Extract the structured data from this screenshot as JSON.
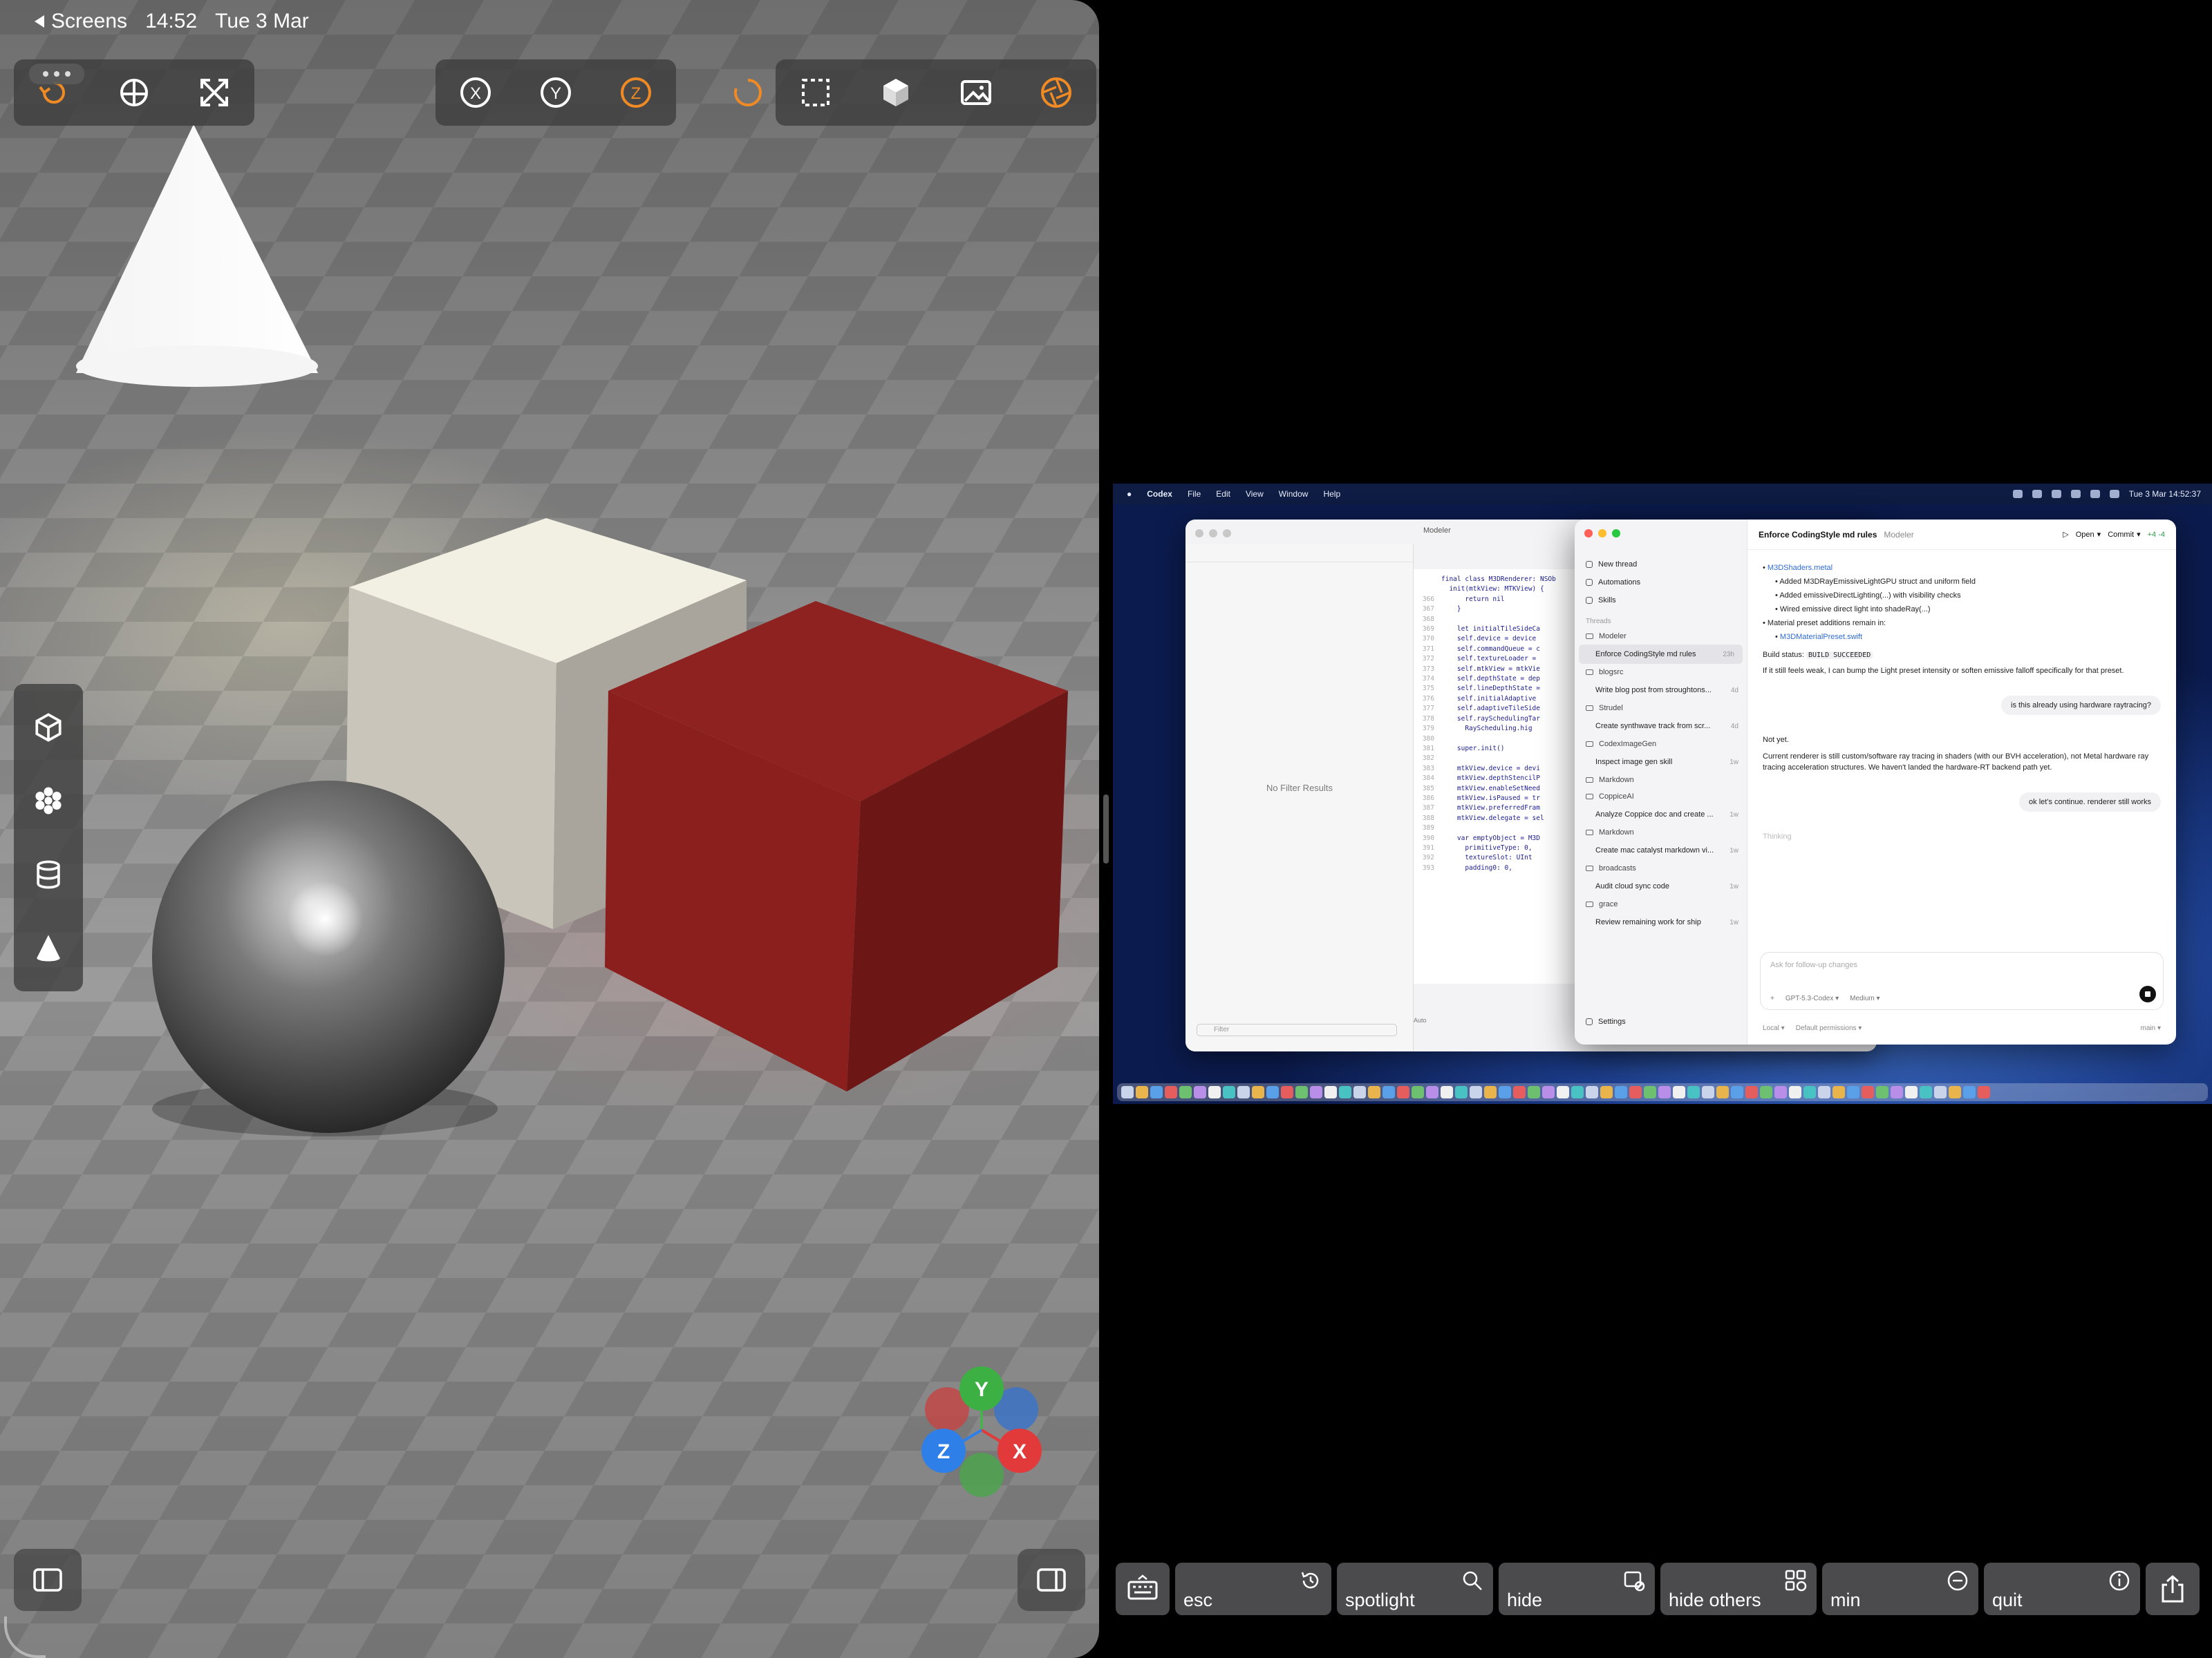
{
  "status_bar": {
    "back_label": "Screens",
    "time": "14:52",
    "date": "Tue 3 Mar"
  },
  "toolbar_left": {
    "icons": [
      "undo-icon",
      "globe-icon",
      "fullscreen-icon"
    ]
  },
  "toolbar_axes": {
    "x": "X",
    "y": "Y",
    "z": "Z"
  },
  "toolbar_right": {
    "icons": [
      "selection-icon",
      "cube-icon",
      "image-icon",
      "aperture-icon"
    ]
  },
  "side_toolbar": {
    "icons": [
      "cube-icon",
      "flower-icon",
      "database-icon",
      "cone-icon"
    ]
  },
  "gizmo": {
    "y": "Y",
    "z": "Z",
    "x": "X"
  },
  "colors": {
    "accent": "#f08a24",
    "gizmo_x": "#e23a3a",
    "gizmo_y": "#3cb043",
    "gizmo_z": "#2f7fe8",
    "red_cube": "#8e2220"
  },
  "mac": {
    "menubar": {
      "app": "Codex",
      "items": [
        "File",
        "Edit",
        "View",
        "Window",
        "Help"
      ],
      "clock": "Tue 3 Mar 14:52:37"
    },
    "xcode": {
      "project": "Modeler",
      "no_filter": "No Filter Results",
      "filter_placeholder": "Filter",
      "lines": [
        {
          "n": "",
          "c": "final class M3DRenderer: NSOb"
        },
        {
          "n": "",
          "c": "  init(mtkView: MTKView) {"
        },
        {
          "n": "366",
          "c": "      return nil"
        },
        {
          "n": "367",
          "c": "    }"
        },
        {
          "n": "368",
          "c": ""
        },
        {
          "n": "369",
          "c": "    let initialTileSideCa"
        },
        {
          "n": "370",
          "c": "    self.device = device"
        },
        {
          "n": "371",
          "c": "    self.commandQueue = c"
        },
        {
          "n": "372",
          "c": "    self.textureLoader = "
        },
        {
          "n": "373",
          "c": "    self.mtkView = mtkVie"
        },
        {
          "n": "374",
          "c": "    self.depthState = dep"
        },
        {
          "n": "375",
          "c": "    self.lineDepthState ="
        },
        {
          "n": "376",
          "c": "    self.initialAdaptive"
        },
        {
          "n": "377",
          "c": "    self.adaptiveTileSide"
        },
        {
          "n": "378",
          "c": "    self.raySchedulingTar"
        },
        {
          "n": "379",
          "c": "      RayScheduling.hig"
        },
        {
          "n": "380",
          "c": ""
        },
        {
          "n": "381",
          "c": "    super.init()"
        },
        {
          "n": "382",
          "c": ""
        },
        {
          "n": "383",
          "c": "    mtkView.device = devi"
        },
        {
          "n": "384",
          "c": "    mtkView.depthStencilP"
        },
        {
          "n": "385",
          "c": "    mtkView.enableSetNeed"
        },
        {
          "n": "386",
          "c": "    mtkView.isPaused = tr"
        },
        {
          "n": "387",
          "c": "    mtkView.preferredFram"
        },
        {
          "n": "388",
          "c": "    mtkView.delegate = sel"
        },
        {
          "n": "389",
          "c": ""
        },
        {
          "n": "390",
          "c": "    var emptyObject = M3D"
        },
        {
          "n": "391",
          "c": "      primitiveType: 0,"
        },
        {
          "n": "392",
          "c": "      textureSlot: UInt"
        },
        {
          "n": "393",
          "c": "      padding0: 0,"
        }
      ],
      "bottom_label": "Auto"
    },
    "codex": {
      "sidebar_top": [
        "New thread",
        "Automations",
        "Skills"
      ],
      "threads_header": "Threads",
      "groups": [
        {
          "folder": "Modeler",
          "threads": [
            {
              "title": "Enforce CodingStyle md rules",
              "age": "23h",
              "selected": true
            }
          ]
        },
        {
          "folder": "blogsrc",
          "threads": [
            {
              "title": "Write blog post from stroughtons...",
              "age": "4d"
            }
          ]
        },
        {
          "folder": "Strudel",
          "threads": [
            {
              "title": "Create synthwave track from scr...",
              "age": "4d"
            }
          ]
        },
        {
          "folder": "CodexImageGen",
          "threads": [
            {
              "title": "Inspect image gen skill",
              "age": "1w"
            }
          ]
        },
        {
          "folder": "Markdown",
          "threads": []
        },
        {
          "folder": "CoppiceAI",
          "threads": [
            {
              "title": "Analyze Coppice doc and create ...",
              "age": "1w"
            }
          ]
        },
        {
          "folder": "Markdown",
          "threads": [
            {
              "title": "Create mac catalyst markdown vi...",
              "age": "1w"
            }
          ]
        },
        {
          "folder": "broadcasts",
          "threads": [
            {
              "title": "Audit cloud sync code",
              "age": "1w"
            }
          ]
        },
        {
          "folder": "grace",
          "threads": [
            {
              "title": "Review remaining work for ship",
              "age": "1w"
            }
          ]
        }
      ],
      "settings": "Settings",
      "topbar": {
        "title": "Enforce CodingStyle md rules",
        "project": "Modeler",
        "open": "Open",
        "commit": "Commit",
        "diff": "+4 -4"
      },
      "messages": {
        "file1": "M3DShaders.metal",
        "b1": "Added  M3DRayEmissiveLightGPU  struct and uniform field",
        "b2": "Added  emissiveDirectLighting(...)  with visibility checks",
        "b3": "Wired emissive direct light into  shadeRay(...)",
        "b4": "Material preset additions remain in:",
        "file2": "M3DMaterialPreset.swift",
        "build_label": "Build status:",
        "build_value": "BUILD SUCCEEDED",
        "follow": "If it still feels weak, I can bump the  Light  preset intensity or soften emissive falloff specifically for that preset.",
        "user1": "is this already using hardware raytracing?",
        "reply1": "Not yet.",
        "reply2": "Current renderer is still custom/software ray tracing in shaders (with our BVH acceleration), not Metal hardware ray tracing acceleration structures. We haven't landed the hardware-RT backend path yet.",
        "user2": "ok let's continue. renderer still works",
        "thinking": "Thinking"
      },
      "composer": {
        "placeholder": "Ask for follow-up changes",
        "model": "GPT-5.3-Codex",
        "effort": "Medium"
      },
      "footer": {
        "local": "Local",
        "permissions": "Default permissions",
        "branch": "main"
      }
    }
  },
  "keybar": [
    {
      "label": "esc",
      "icon": "history-icon"
    },
    {
      "label": "spotlight",
      "icon": "search-icon"
    },
    {
      "label": "hide",
      "icon": "hide-window-icon"
    },
    {
      "label": "hide others",
      "icon": "hide-others-icon"
    },
    {
      "label": "min",
      "icon": "minus-circle-icon"
    },
    {
      "label": "quit",
      "icon": "info-circle-icon"
    }
  ]
}
